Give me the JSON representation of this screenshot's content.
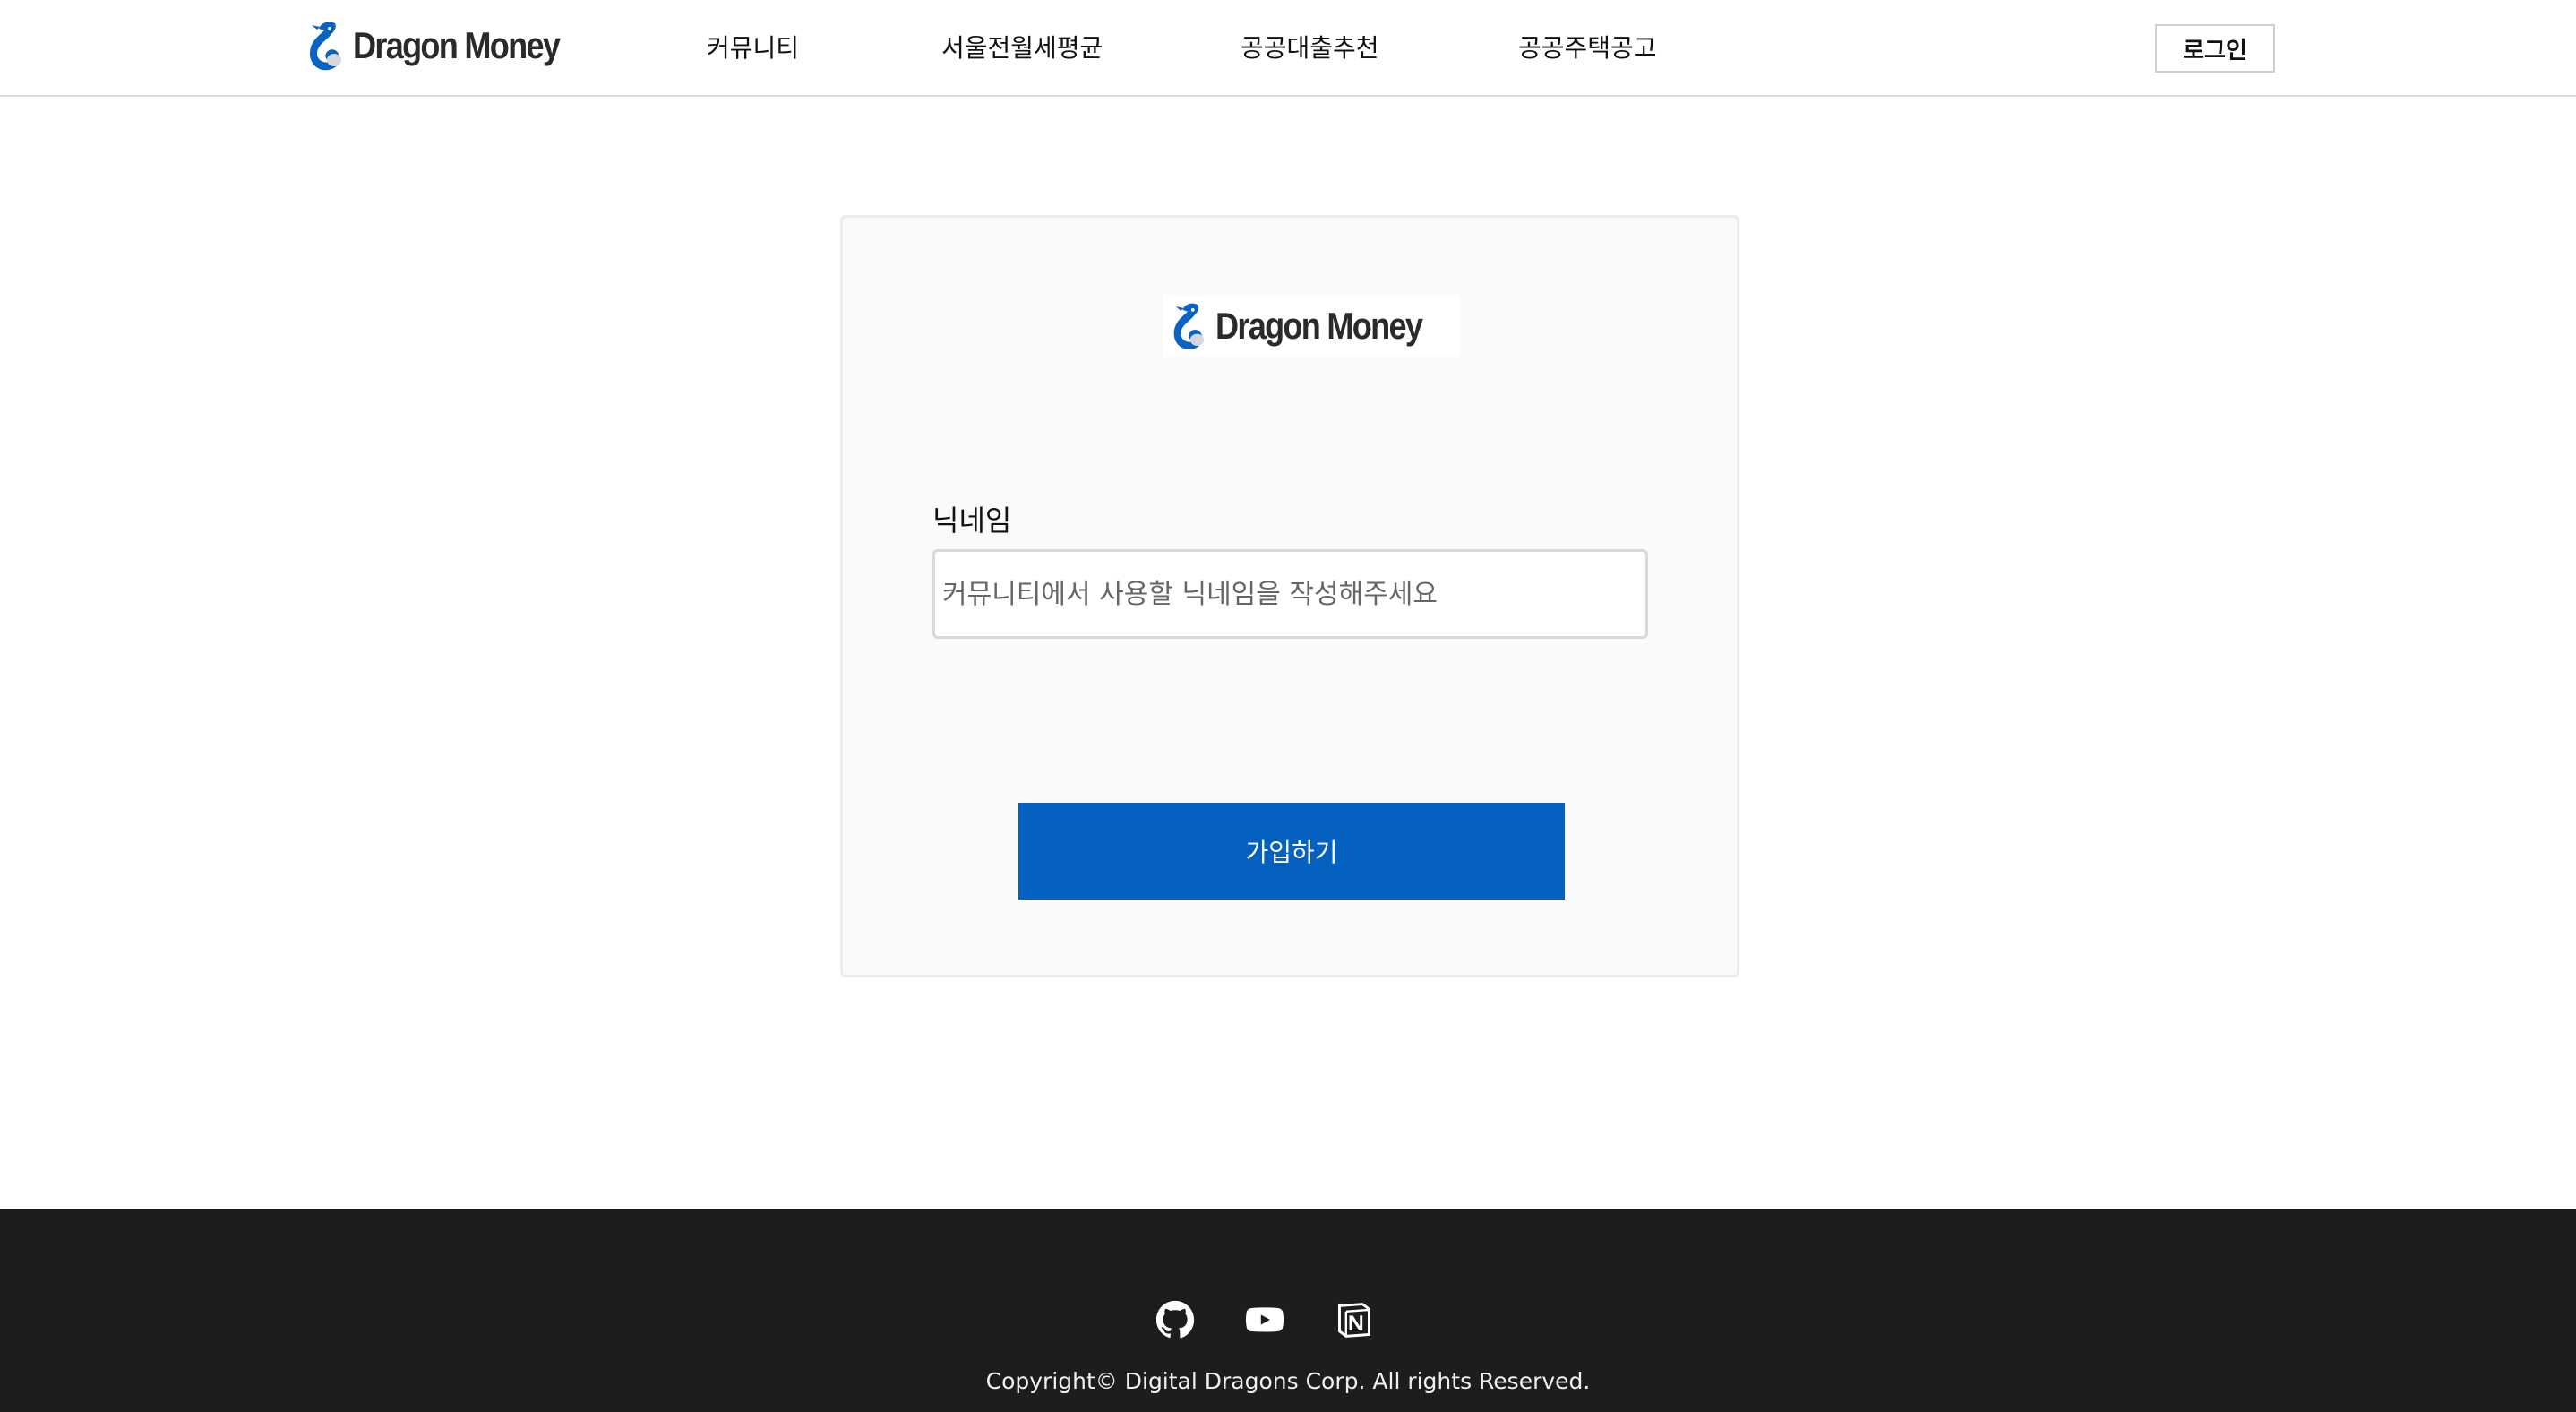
{
  "brand": {
    "name": "Dragon Money",
    "colors": {
      "primary": "#0461c0",
      "footer_bg": "#1d1d1d"
    }
  },
  "header": {
    "nav": [
      {
        "label": "커뮤니티"
      },
      {
        "label": "서울전월세평균"
      },
      {
        "label": "공공대출추천"
      },
      {
        "label": "공공주택공고"
      }
    ],
    "login_label": "로그인"
  },
  "signup": {
    "nickname_label": "닉네임",
    "nickname_placeholder": "커뮤니티에서 사용할 닉네임을 작성해주세요",
    "nickname_value": "",
    "submit_label": "가입하기"
  },
  "footer": {
    "icons": [
      "github-icon",
      "youtube-icon",
      "notion-icon"
    ],
    "copyright": "Copyright© Digital Dragons Corp. All rights Reserved."
  }
}
